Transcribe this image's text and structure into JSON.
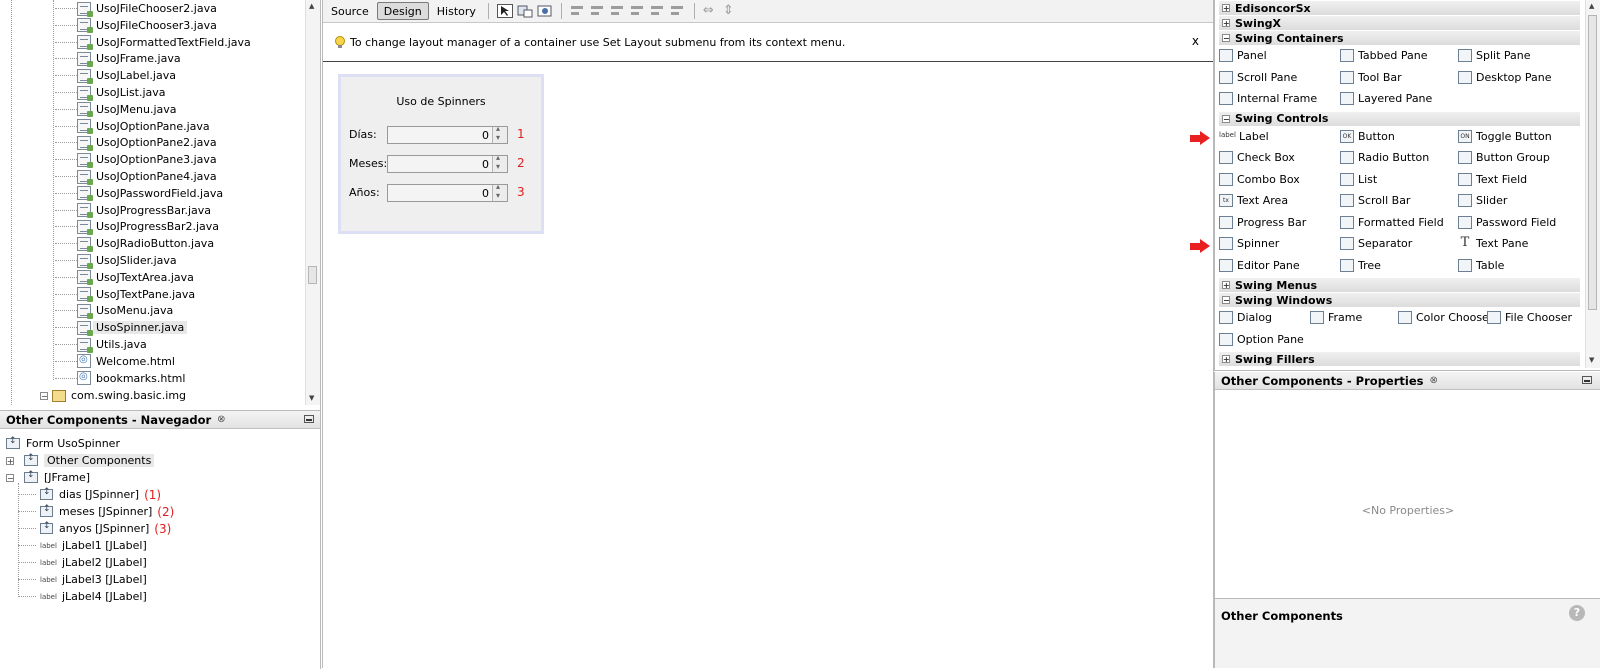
{
  "project_tree": {
    "files": [
      {
        "name": "UsoJFileChooser2.java",
        "type": "java"
      },
      {
        "name": "UsoJFileChooser3.java",
        "type": "java"
      },
      {
        "name": "UsoJFormattedTextField.java",
        "type": "java"
      },
      {
        "name": "UsoJFrame.java",
        "type": "java"
      },
      {
        "name": "UsoJLabel.java",
        "type": "java"
      },
      {
        "name": "UsoJList.java",
        "type": "java"
      },
      {
        "name": "UsoJMenu.java",
        "type": "java"
      },
      {
        "name": "UsoJOptionPane.java",
        "type": "java"
      },
      {
        "name": "UsoJOptionPane2.java",
        "type": "java"
      },
      {
        "name": "UsoJOptionPane3.java",
        "type": "java"
      },
      {
        "name": "UsoJOptionPane4.java",
        "type": "java"
      },
      {
        "name": "UsoJPasswordField.java",
        "type": "java"
      },
      {
        "name": "UsoJProgressBar.java",
        "type": "java"
      },
      {
        "name": "UsoJProgressBar2.java",
        "type": "java"
      },
      {
        "name": "UsoJRadioButton.java",
        "type": "java"
      },
      {
        "name": "UsoJSlider.java",
        "type": "java"
      },
      {
        "name": "UsoJTextArea.java",
        "type": "java"
      },
      {
        "name": "UsoJTextPane.java",
        "type": "java"
      },
      {
        "name": "UsoMenu.java",
        "type": "java"
      },
      {
        "name": "UsoSpinner.java",
        "type": "java",
        "selected": true
      },
      {
        "name": "Utils.java",
        "type": "java"
      },
      {
        "name": "Welcome.html",
        "type": "html"
      },
      {
        "name": "bookmarks.html",
        "type": "html"
      }
    ],
    "package": "com.swing.basic.img"
  },
  "navigator": {
    "title": "Other Components - Navegador",
    "close_glyph": "⊗",
    "form_label": "Form UsoSpinner",
    "other_components": "Other Components",
    "jframe": "[JFrame]",
    "children": [
      {
        "label": "dias [JSpinner]",
        "kind": "spinner",
        "note": "(1)"
      },
      {
        "label": "meses [JSpinner]",
        "kind": "spinner",
        "note": "(2)"
      },
      {
        "label": "anyos [JSpinner]",
        "kind": "spinner",
        "note": "(3)"
      },
      {
        "label": "jLabel1 [JLabel]",
        "kind": "label",
        "note": ""
      },
      {
        "label": "jLabel2 [JLabel]",
        "kind": "label",
        "note": ""
      },
      {
        "label": "jLabel3 [JLabel]",
        "kind": "label",
        "note": ""
      },
      {
        "label": "jLabel4 [JLabel]",
        "kind": "label",
        "note": ""
      }
    ],
    "label_icon_text": "label"
  },
  "editor": {
    "tabs": [
      "Source",
      "Design",
      "History"
    ],
    "active_tab": "Design",
    "info_message": "To change layout manager of a container use Set Layout submenu from its context menu.",
    "info_close": "x",
    "form": {
      "title": "Uso de Spinners",
      "rows": [
        {
          "label": "Días:",
          "value": "0",
          "marker": "1"
        },
        {
          "label": "Meses:",
          "value": "0",
          "marker": "2"
        },
        {
          "label": "Años:",
          "value": "0",
          "marker": "3"
        }
      ]
    }
  },
  "palette": {
    "categories": [
      {
        "name": "EdisoncorSx",
        "expanded": false
      },
      {
        "name": "SwingX",
        "expanded": false
      },
      {
        "name": "Swing Containers",
        "expanded": true,
        "items": [
          "Panel",
          "Tabbed Pane",
          "Split Pane",
          "Scroll Pane",
          "Tool Bar",
          "Desktop Pane",
          "Internal Frame",
          "Layered Pane"
        ]
      },
      {
        "name": "Swing Controls",
        "expanded": true,
        "items": [
          "Label",
          "Button",
          "Toggle Button",
          "Check Box",
          "Radio Button",
          "Button Group",
          "Combo Box",
          "List",
          "Text Field",
          "Text Area",
          "Scroll Bar",
          "Slider",
          "Progress Bar",
          "Formatted Field",
          "Password Field",
          "Spinner",
          "Separator",
          "Text Pane",
          "Editor Pane",
          "Tree",
          "Table"
        ]
      },
      {
        "name": "Swing Menus",
        "expanded": false
      },
      {
        "name": "Swing Windows",
        "expanded": true,
        "items": [
          "Dialog",
          "Frame",
          "Color Chooser",
          "File Chooser",
          "Option Pane"
        ]
      },
      {
        "name": "Swing Fillers",
        "expanded": false
      }
    ],
    "icon_texts": {
      "label": "label",
      "button": "OK",
      "toggle": "ON",
      "textarea": "tx",
      "textpane": "T"
    }
  },
  "properties": {
    "title": "Other Components - Properties",
    "close_glyph": "⊗",
    "empty_text": "<No Properties>",
    "footer_title": "Other Components",
    "help_glyph": "?"
  },
  "colors": {
    "accent_red": "#e02020",
    "selection": "#e8e8e8"
  }
}
